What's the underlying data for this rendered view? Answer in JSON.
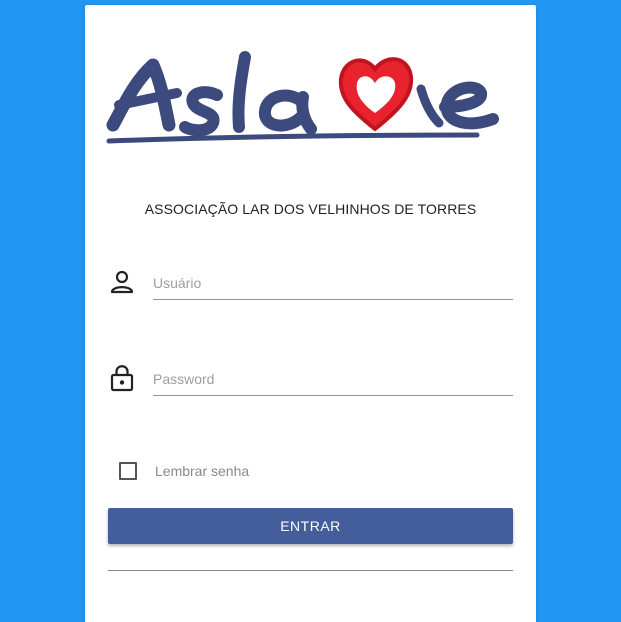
{
  "logo": {
    "text": "Aslave",
    "text_color": "#3c4a7d",
    "heart_color": "#e8232d"
  },
  "org": {
    "name": "ASSOCIAÇÃO LAR DOS VELHINHOS DE TORRES"
  },
  "form": {
    "username": {
      "icon": "person-icon",
      "placeholder": "Usuário",
      "value": ""
    },
    "password": {
      "icon": "lock-icon",
      "placeholder": "Password",
      "value": ""
    },
    "remember": {
      "label": "Lembrar senha",
      "checked": false
    },
    "submit_label": "ENTRAR"
  },
  "colors": {
    "page_background": "#2196f3",
    "card_background": "#ffffff",
    "button_background": "#445e9b"
  }
}
